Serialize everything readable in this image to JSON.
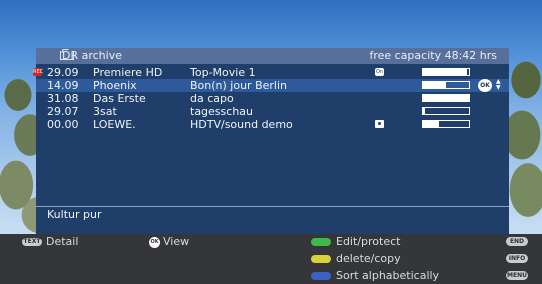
{
  "header": {
    "title": "DR archive",
    "free_capacity": "free capacity 48:42 hrs"
  },
  "recordings": [
    {
      "date": "29.09",
      "channel": "Premiere HD",
      "title": "Top-Movie 1",
      "progress": 0.95,
      "icon": "lock-icon",
      "icon_text": "On",
      "rec_badge": "REC"
    },
    {
      "date": "14.09",
      "channel": "Phoenix",
      "title": "Bon(n) jour Berlin",
      "progress": 0.5,
      "icon": "ok-icon",
      "ok_text": "OK",
      "selected": true
    },
    {
      "date": "31.08",
      "channel": "Das Erste",
      "title": "da capo",
      "progress": 1.0
    },
    {
      "date": "29.07",
      "channel": "3sat",
      "title": "tagesschau",
      "progress": 0.05
    },
    {
      "date": "00.00",
      "channel": "LOEWE.",
      "title": "HDTV/sound demo",
      "progress": 0.35,
      "icon": "camera-icon"
    }
  ],
  "info_text": "Kultur pur",
  "footer": {
    "detail_key": "TEXT",
    "detail_label": "Detail",
    "view_key": "OK",
    "view_label": "View",
    "edit_label": "Edit/protect",
    "delete_label": "delete/copy",
    "sort_label": "Sort alphabetically",
    "end_key": "END",
    "info_key": "INFO",
    "menu_key": "MENU"
  },
  "colors": {
    "green": "#3fb84a",
    "yellow": "#d8d23a",
    "blue": "#3a62c8",
    "panel": "#203e6a",
    "selected_row": "#2f5a99"
  }
}
